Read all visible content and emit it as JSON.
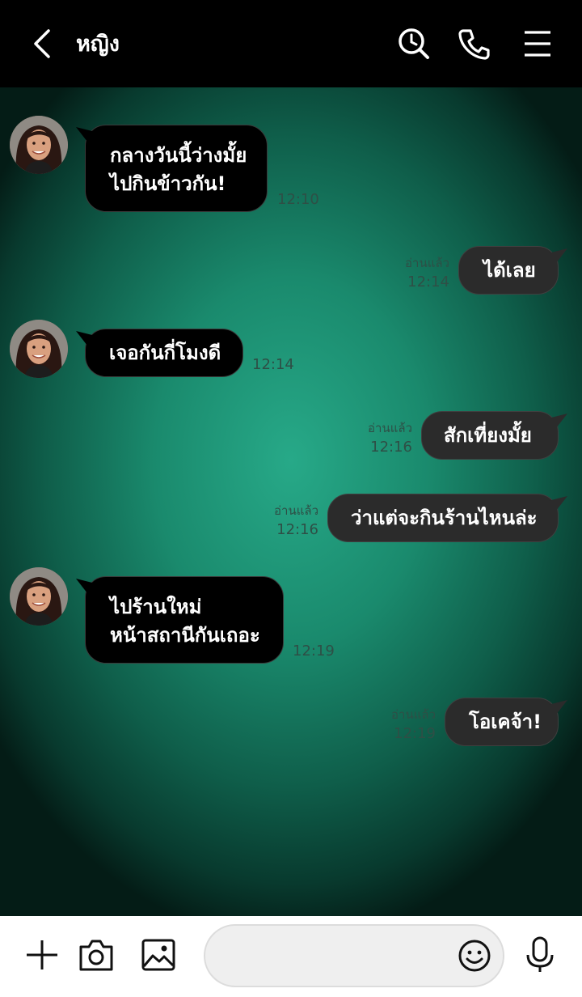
{
  "header": {
    "title": "หญิง",
    "icons": [
      "back-icon",
      "history-search-icon",
      "phone-icon",
      "menu-icon"
    ]
  },
  "messages": [
    {
      "side": "in",
      "lines": [
        "กลางวันนี้ว่างมั้ย",
        "ไปกินข้าวกัน!"
      ],
      "time": "12:10"
    },
    {
      "side": "out",
      "text": "ได้เลย",
      "status": "อ่านแล้ว",
      "time": "12:14"
    },
    {
      "side": "in",
      "text": "เจอกันกี่โมงดี",
      "time": "12:14"
    },
    {
      "side": "out",
      "text": "สักเที่ยงมั้ย",
      "status": "อ่านแล้ว",
      "time": "12:16"
    },
    {
      "side": "out",
      "text": "ว่าแต่จะกินร้านไหนล่ะ",
      "status": "อ่านแล้ว",
      "time": "12:16"
    },
    {
      "side": "in",
      "lines": [
        "ไปร้านใหม่",
        "หน้าสถานีกันเถอะ"
      ],
      "time": "12:19"
    },
    {
      "side": "out",
      "text": "โอเคจ้า!",
      "status": "อ่านแล้ว",
      "time": "12:19"
    }
  ],
  "footer": {
    "input_value": "",
    "icons": [
      "plus-icon",
      "camera-icon",
      "image-icon",
      "emoji-icon",
      "microphone-icon"
    ]
  },
  "colors": {
    "accent": "#1f9a7a",
    "header_bg": "#000000",
    "bubble_in": "#000000",
    "bubble_out": "#2b2b2b"
  }
}
